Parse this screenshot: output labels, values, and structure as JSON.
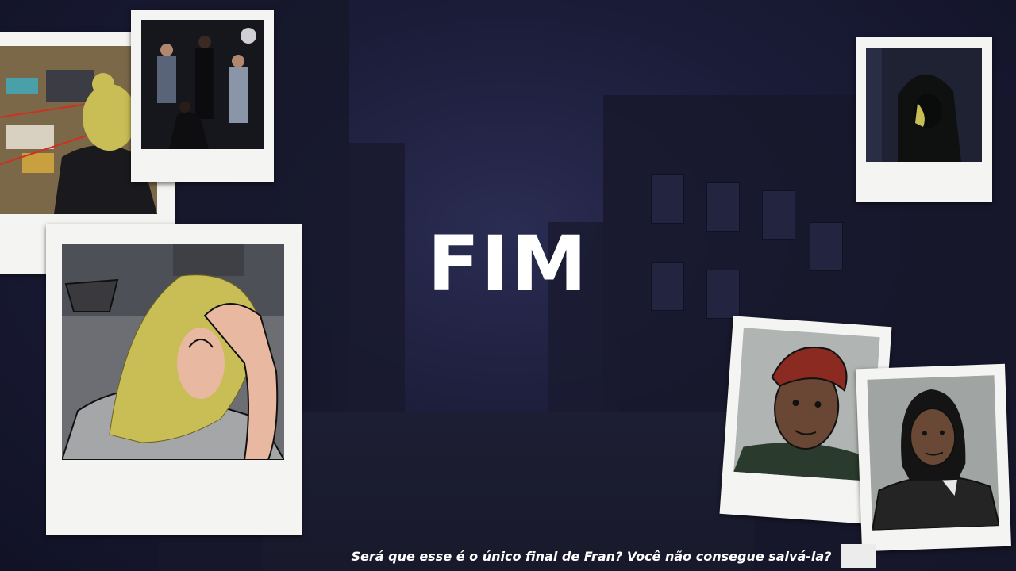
{
  "screen": {
    "title": "FIM",
    "caption": "Será que esse é o único final de Fran? Você não consegue salvá-la?"
  },
  "colors": {
    "background": "#1b1c38",
    "frame": "#f4f4f2",
    "title_text": "#ffffff",
    "hair_blonde": "#c9bd55"
  },
  "photos": [
    {
      "name": "photo-blonde-woman-map"
    },
    {
      "name": "photo-four-people-dark-room"
    },
    {
      "name": "photo-hooded-figure"
    },
    {
      "name": "photo-blonde-woman-head-in-hand"
    },
    {
      "name": "photo-woman-red-headwrap"
    },
    {
      "name": "photo-woman-dark-hair-jacket"
    }
  ]
}
